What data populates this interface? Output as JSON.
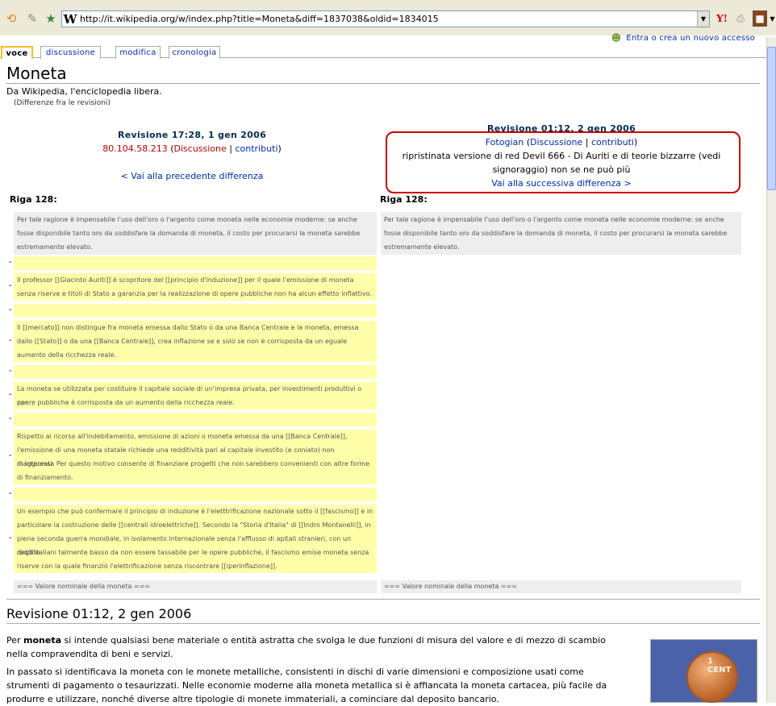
{
  "browser": {
    "url": "http://it.wikipedia.org/w/index.php?title=Moneta&diff=1837038&oldid=1834015",
    "site_letter": "W"
  },
  "login": {
    "label": "Entra o crea un nuovo accesso"
  },
  "tabs": [
    {
      "label": "voce"
    },
    {
      "label": "discussione"
    },
    {
      "label": "modifica"
    },
    {
      "label": "cronologia"
    }
  ],
  "page": {
    "title": "Moneta",
    "tagline": "Da Wikipedia, l'enciclopedia libera.",
    "diff_note": "(Differenze fra le revisioni)"
  },
  "left_rev": {
    "title": "Revisione 17:28, 1 gen 2006",
    "user": "80.104.58.213",
    "open_paren": " (",
    "discussion": "Discussione",
    "sep": " | ",
    "contrib": "contributi",
    "close_paren": ")",
    "nav": "< Vai alla precedente differenza"
  },
  "right_rev": {
    "title": "Revisione 01:12, 2 gen 2006",
    "user": "Fotogian",
    "open_paren": " (",
    "discussion": "Discussione",
    "sep": " | ",
    "contrib": "contributi",
    "close_paren": ")",
    "summary1": "ripristinata versione di red Devil 666 - Di Auriti e di teorie bizzarre (vedi",
    "summary2": "signoraggio) non se ne può più",
    "nav": "Vai alla successiva differenza >"
  },
  "diff": {
    "riga_left": "Riga 128:",
    "riga_right": "Riga 128:",
    "context_lines": [
      "Per tale ragione è impensabile l'uso dell'oro o l'argento come moneta nelle economie moderne: se anche",
      "fosse disponibile tanto oro da soddisfare la domanda di moneta, il costo per procurarsi la moneta sarebbe",
      "estremamente elevato."
    ],
    "minus": "-",
    "del_blocks": [
      {
        "lines": [
          ""
        ]
      },
      {
        "lines": [
          "Il professor [[Giacinto Auriti]] è scopritore del [[principio d'induzione]] per il quale l'emissione di moneta",
          "senza riserve e titoli di Stato a garanzia per la realizzazione di opere pubbliche non ha alcun effetto inflattivo."
        ]
      },
      {
        "lines": [
          ""
        ]
      },
      {
        "lines": [
          "Il [[mercato]] non distingue fra moneta emessa dallo Stato o da una Banca Centrale e la moneta, emessa",
          "dallo [[Stato]] o da una [[Banca Centrale]], crea inflazione se e solo se non è corrisposta da un eguale",
          "aumento della ricchezza reale."
        ]
      },
      {
        "lines": [
          ""
        ]
      },
      {
        "lines": [
          "La moneta se utilizzata per costituire il capitale sociale di un'impresa privata, per investimenti produttivi o per",
          "opere pubbliche è corrisposta da un aumento della ricchezza reale."
        ]
      },
      {
        "lines": [
          ""
        ]
      },
      {
        "lines": [
          "Rispetto al ricorso all'indebitamento, emissione di azioni o moneta emessa da una [[Banca Centrale]],",
          "l'emissione di una moneta statale richiede una redditività pari al capitale investito (e coniato) non maggiorata",
          "di interessi. Per questo motivo consente di finanziare progetti che non sarebbero convenienti con altre forme",
          "di finanziamento."
        ]
      },
      {
        "lines": [
          ""
        ]
      },
      {
        "lines": [
          "Un esempio che può confermare il principio di induzione è l'eletttrificazione nazionale sotto il [[fascismo]] e in",
          "particolare la costruzione delle [[centrali idroelettriche]]. Secondo la \"Storia d'Italia\" di [[Indro Montanelli]], in",
          "piena seconda guerra mondiale, in isolamento internazionale senza l'afflusso di apitali stranieri, con un reddito",
          "degli italiani talmente basso da non essere tassabile per le opere pubbliche, il fascismo emise moneta senza",
          "riserve con la quale finanziò l'elettrificazione senza riscontrare [[iperinflazione]]."
        ]
      }
    ],
    "trailing_context": "=== Valore nominale della moneta ==="
  },
  "article": {
    "section_title": "Revisione 01:12, 2 gen 2006",
    "p1_pre": "Per ",
    "p1_bold": "moneta",
    "p1_post": " si intende qualsiasi bene materiale o entità astratta che svolga le due funzioni di misura del valore e di mezzo di scambio",
    "p1_line2": "nella compravendita di beni e servizi.",
    "p2_line1": "In passato si identificava la moneta con le monete metalliche, consistenti in dischi di varie dimensioni e composizione usati come",
    "p2_line2": "strumenti di pagamento o tesaurizzati. Nelle economie moderne alla moneta metallica si è affiancata la moneta cartacea, più facile da",
    "p2_line3": "produrre e utilizzare, nonché diverse altre tipologie di monete immateriali, a cominciare dal deposito bancario.",
    "coin_label": "1 CENT"
  }
}
